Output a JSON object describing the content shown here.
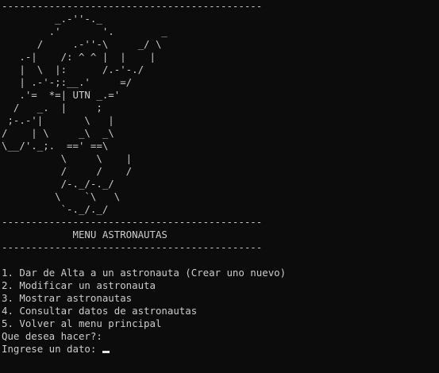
{
  "console": {
    "separator_top": "--------------------------------------------",
    "ascii_art": [
      "         _.-''-._",
      "        .'       '.        _",
      "      /     .-''-\\     _/ \\",
      "   .-|    /: ^ ^ |  |    |",
      "   |  \\  |:      /.-'-./",
      "   | .-'-;:__.'     =/",
      "   .'=  *=| UTN _.='",
      "  /   _.  |     ;",
      " ;-.-'|       \\   |",
      "/    | \\     _\\  _\\",
      "\\__/'._;.  ==' ==\\",
      "          \\     \\    |",
      "          /     /    /",
      "          /-._/-._/",
      "         \\    `\\   \\",
      "          `-._/._/"
    ],
    "separator_mid": "--------------------------------------------",
    "menu_title": "            MENU ASTRONAUTAS",
    "separator_bottom": "--------------------------------------------",
    "blank": "",
    "options": [
      "1. Dar de Alta a un astronauta (Crear uno nuevo)",
      "2. Modificar un astronauta",
      "3. Mostrar astronautas",
      "4. Consultar datos de astronautas",
      "5. Volver al menu principal"
    ],
    "prompt_question": "Que desea hacer?:",
    "prompt_input": "Ingrese un dato: "
  }
}
